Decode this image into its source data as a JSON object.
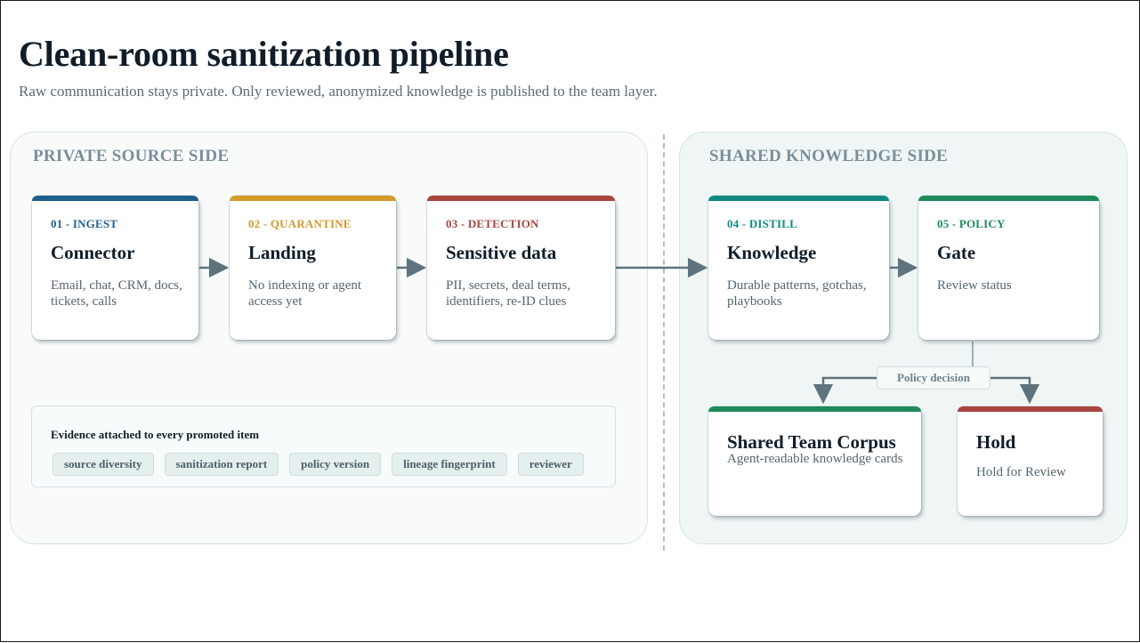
{
  "header": {
    "title": "Clean-room sanitization pipeline",
    "subtitle": "Raw communication stays private. Only reviewed, anonymized knowledge is published to the team layer."
  },
  "private_side": {
    "title": "PRIVATE SOURCE SIDE",
    "stages": [
      {
        "step": "01 - INGEST",
        "name": "Connector",
        "desc": "Email, chat, CRM, docs, tickets, calls",
        "color": "#1f5f8b"
      },
      {
        "step": "02 - QUARANTINE",
        "name": "Landing",
        "desc": "No indexing or agent access yet",
        "color": "#d49a2a"
      },
      {
        "step": "03 - DETECTION",
        "name": "Sensitive data",
        "desc": "PII, secrets, deal terms, identifiers, re-ID clues",
        "color": "#a8463f"
      }
    ],
    "evidence": {
      "title": "Evidence attached to every promoted item",
      "chips": [
        "source diversity",
        "sanitization report",
        "policy version",
        "lineage fingerprint",
        "reviewer"
      ]
    }
  },
  "shared_side": {
    "title": "SHARED KNOWLEDGE SIDE",
    "stages": [
      {
        "step": "04 - DISTILL",
        "name": "Knowledge",
        "desc": "Durable patterns, gotchas, playbooks",
        "color": "#128a82"
      },
      {
        "step": "05 - POLICY",
        "name": "Gate",
        "desc": "Review status",
        "color": "#1e8a5a"
      }
    ],
    "decision_label": "Policy decision",
    "outcomes": [
      {
        "name": "Shared Team Corpus",
        "desc": "Agent-readable knowledge cards",
        "color": "#1e8a5a"
      },
      {
        "name": "Hold",
        "desc": "Hold for Review",
        "color": "#a8463f"
      }
    ]
  }
}
